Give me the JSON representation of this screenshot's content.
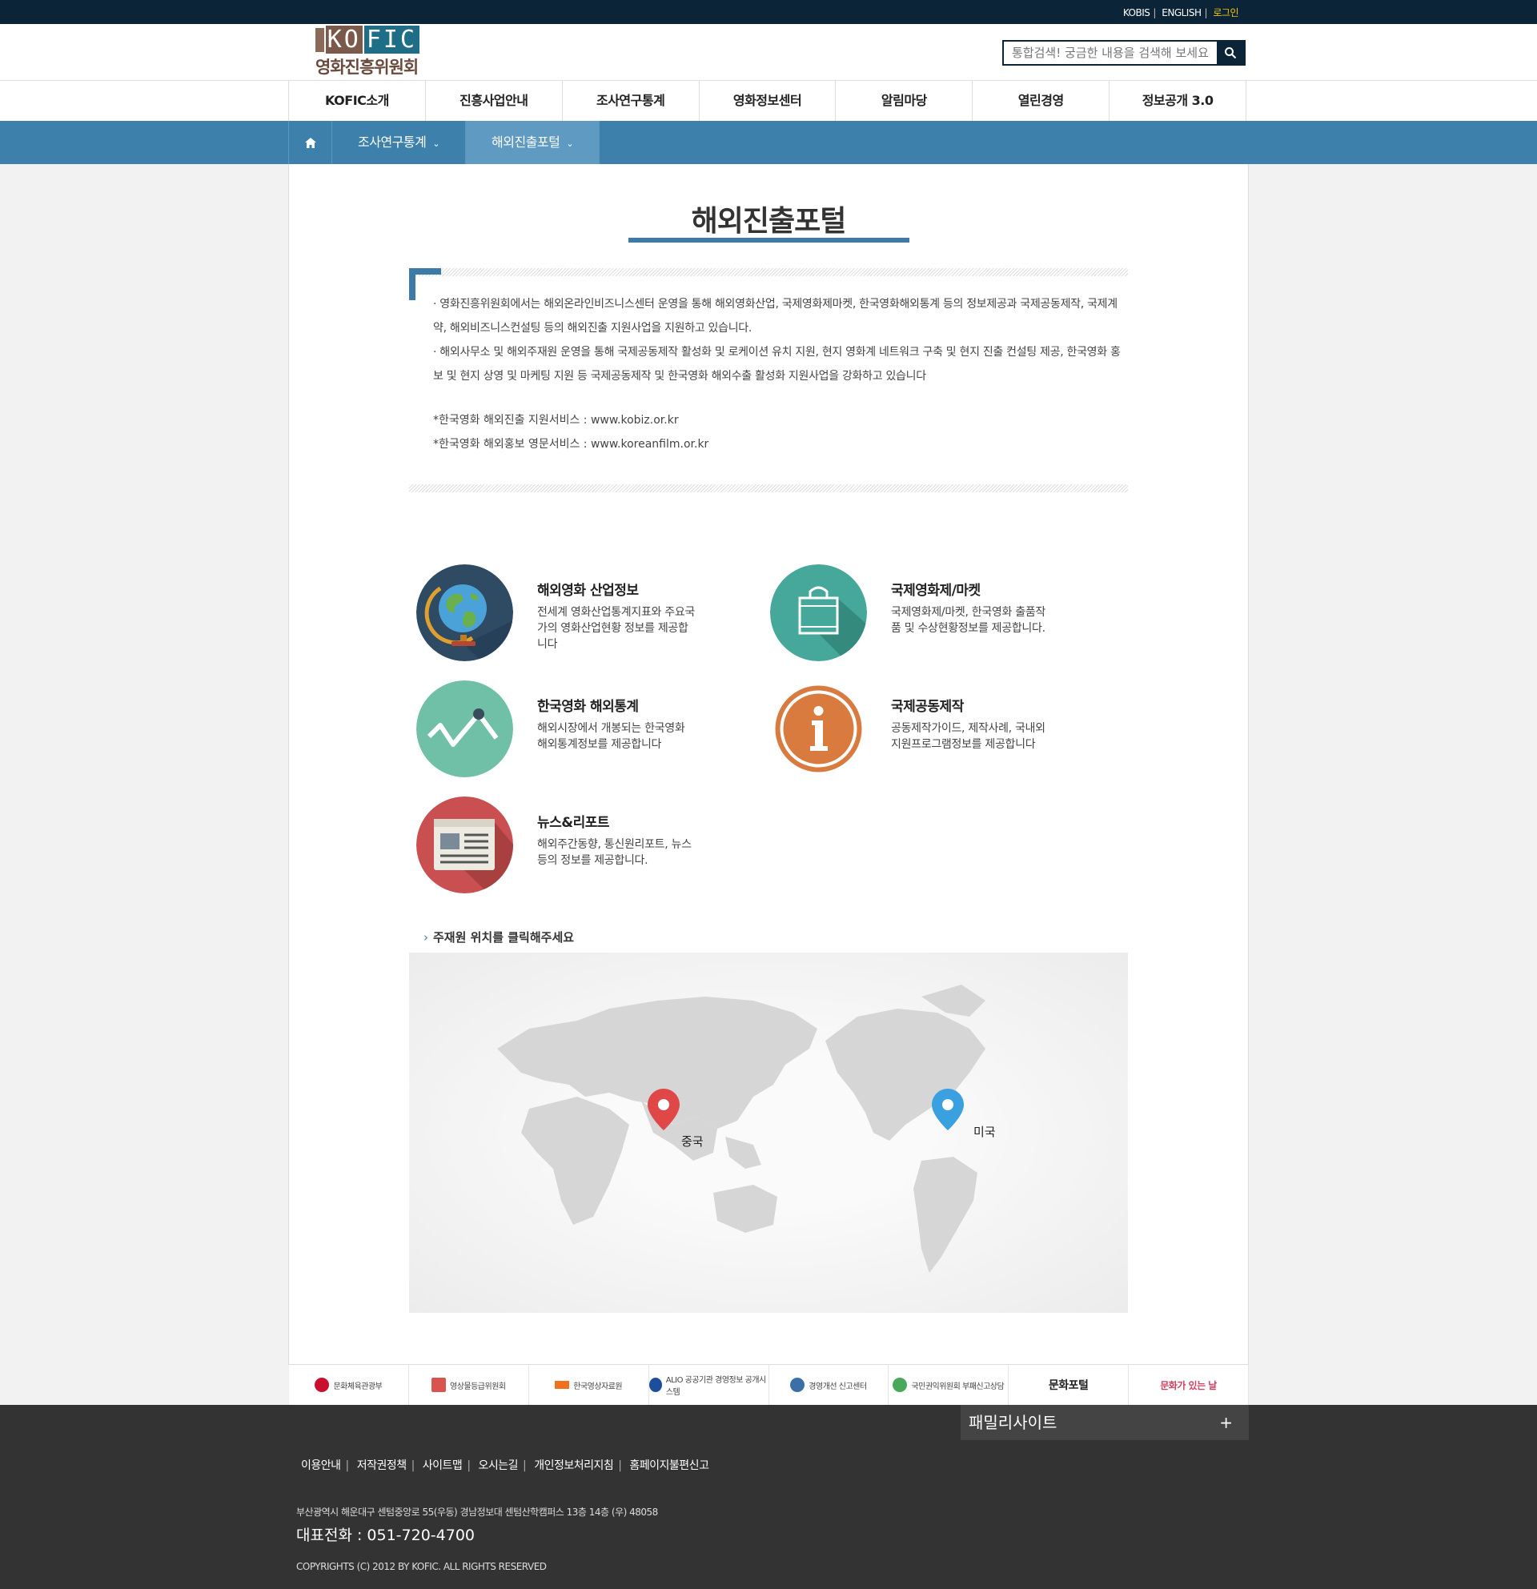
{
  "topbar": {
    "links": [
      "KOBIS",
      "ENGLISH"
    ],
    "login": "로그인"
  },
  "header": {
    "logo_text": "KOFIC",
    "logo_korean": "영화진흥위원회",
    "search_placeholder": "통합검색! 궁금한 내용을 검색해 보세요"
  },
  "nav": {
    "items": [
      "KOFIC소개",
      "진흥사업안내",
      "조사연구통계",
      "영화정보센터",
      "알림마당",
      "열린경영",
      "정보공개 3.0"
    ]
  },
  "breadcrumb": {
    "level1": "조사연구통계",
    "level2": "해외진출포털"
  },
  "page": {
    "title": "해외진출포털",
    "intro": [
      "· 영화진흥위원회에서는 해외온라인비즈니스센터 운영을 통해 해외영화산업, 국제영화제마켓, 한국영화해외통계 등의 정보제공과 국제공동제작, 국제계약, 해외비즈니스컨설팅 등의 해외진출 지원사업을 지원하고 있습니다.",
      "· 해외사무소 및 해외주재원 운영을 통해 국제공동제작 활성화 및 로케이션 유치 지원, 현지 영화계 네트워크 구축 및 현지 진출 컨설팅 제공, 한국영화 홍보 및 현지 상영 및 마케팅 지원 등 국제공동제작 및 한국영화 해외수출 활성화 지원사업을 강화하고 있습니다"
    ],
    "service_links": [
      "*한국영화 해외진출 지원서비스 : www.kobiz.or.kr",
      "*한국영화 해외홍보 영문서비스 : www.koreanfilm.or.kr"
    ]
  },
  "services": [
    {
      "title": "해외영화 산업정보",
      "desc": "전세계 영화산업통계지표와 주요국가의 영화산업현황 정보를 제공합니다",
      "icon": "globe-icon",
      "color": "#2f4a63"
    },
    {
      "title": "국제영화제/마켓",
      "desc": "국제영화제/마켓, 한국영화 출품작품 및 수상현황정보를 제공합니다.",
      "icon": "shopping-bag-icon",
      "color": "#45a89a"
    },
    {
      "title": "한국영화 해외통계",
      "desc": "해외시장에서 개봉되는 한국영화 해외통계정보를 제공합니다",
      "icon": "line-chart-icon",
      "color": "#6fc0a6"
    },
    {
      "title": "국제공동제작",
      "desc": "공동제작가이드, 제작사례, 국내외지원프로그램정보를 제공합니다",
      "icon": "info-icon",
      "color": "#d97b3f"
    },
    {
      "title": "뉴스&리포트",
      "desc": "해외주간동향, 통신원리포트, 뉴스 등의 정보를 제공합니다.",
      "icon": "newspaper-icon",
      "color": "#c94f50"
    }
  ],
  "map": {
    "heading": "주재원 위치를 클릭해주세요",
    "markers": [
      {
        "label": "중국",
        "color": "#e04848"
      },
      {
        "label": "미국",
        "color": "#3aa0e0"
      }
    ]
  },
  "partners": [
    "문화체육관광부",
    "영상물등급위원회",
    "한국영상자료원",
    "ALIO 공공기관 경영정보 공개시스템",
    "경영개선 신고센터",
    "국민권익위원회 부패신고상담",
    "문화포털",
    "문화가 있는 날"
  ],
  "footer": {
    "family_site": "패밀리사이트",
    "links": [
      "이용안내",
      "저작권정책",
      "사이트맵",
      "오시는길",
      "개인정보처리지침",
      "홈페이지불편신고"
    ],
    "address": "부산광역시 해운대구 센텀중앙로 55(우동) 경남정보대 센텀산학캠퍼스 13층 14층 (우) 48058",
    "tel": "대표전화 : 051-720-4700",
    "copyright": "COPYRIGHTS (C) 2012 BY KOFIC. ALL RIGHTS RESERVED"
  }
}
